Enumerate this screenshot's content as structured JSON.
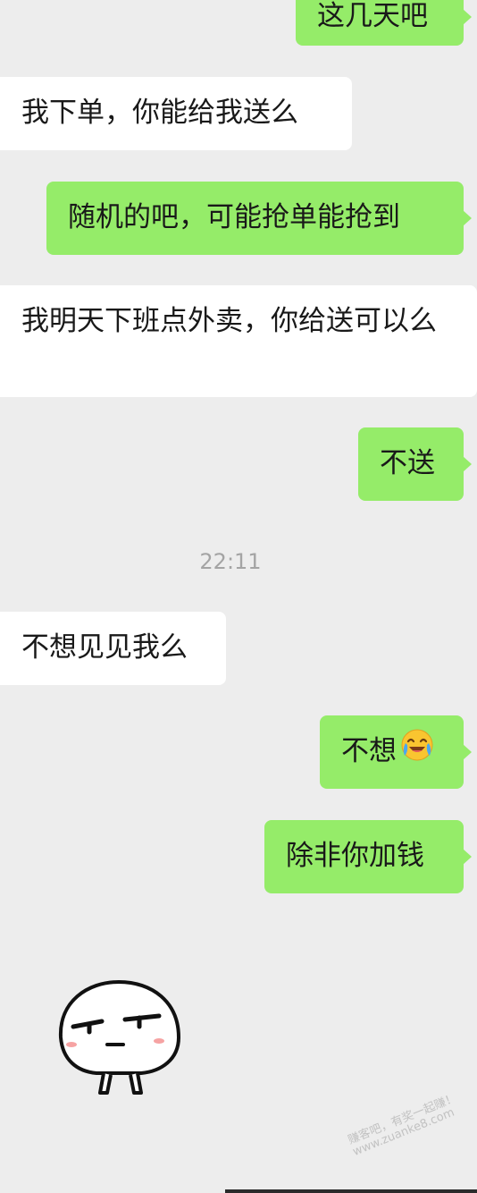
{
  "messages": [
    {
      "side": "out",
      "text": "这几天吧"
    },
    {
      "side": "in",
      "text": "我下单，你能给我送么"
    },
    {
      "side": "out",
      "text": "随机的吧，可能抢单能抢到"
    },
    {
      "side": "in",
      "text": "我明天下班点外卖，你给送可以么"
    },
    {
      "side": "out",
      "text": "不送"
    },
    {
      "side": "in",
      "text": "不想见见我么"
    },
    {
      "side": "out",
      "text": "不想"
    },
    {
      "side": "out",
      "text": "除非你加钱"
    }
  ],
  "timestamp": "22:11",
  "emoji_icon": "laughing-crying-emoji",
  "sticker_icon": "smirking-face-sticker",
  "watermark": {
    "line1": "赚客吧，有奖一起赚！",
    "line2": "www.zuanke8.com"
  },
  "colors": {
    "background": "#ededed",
    "incoming_bubble": "#ffffff",
    "outgoing_bubble": "#95ec69",
    "text": "#191919",
    "timestamp": "#a4a4a4"
  }
}
